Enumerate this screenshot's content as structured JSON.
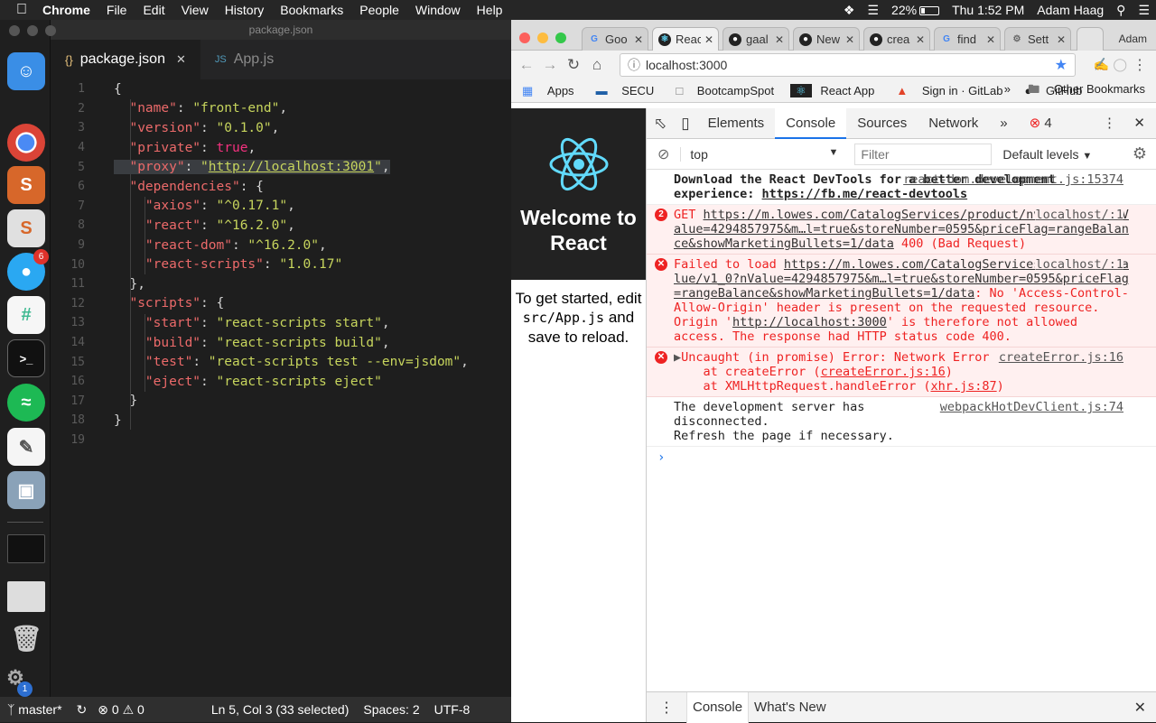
{
  "menubar": {
    "app": "Chrome",
    "items": [
      "File",
      "Edit",
      "View",
      "History",
      "Bookmarks",
      "People",
      "Window",
      "Help"
    ],
    "battery": "22%",
    "clock": "Thu 1:52 PM",
    "user": "Adam Haag"
  },
  "dock": {
    "messages_badge": "6",
    "settings_badge": "1"
  },
  "editor": {
    "window_title": "package.json",
    "tabs": [
      {
        "icon": "{}",
        "label": "package.json"
      },
      {
        "icon": "JS",
        "label": "App.js"
      }
    ],
    "lines": [
      "1",
      "2",
      "3",
      "4",
      "5",
      "6",
      "7",
      "8",
      "9",
      "10",
      "11",
      "12",
      "13",
      "14",
      "15",
      "16",
      "17",
      "18",
      "19"
    ],
    "code": {
      "open": "{",
      "name_key": "\"name\"",
      "name_val": "\"front-end\"",
      "version_key": "\"version\"",
      "version_val": "\"0.1.0\"",
      "private_key": "\"private\"",
      "private_val": "true",
      "proxy_key": "\"proxy\"",
      "proxy_val": "http://localhost:3001",
      "deps_key": "\"dependencies\"",
      "axios_key": "\"axios\"",
      "axios_val": "\"^0.17.1\"",
      "react_key": "\"react\"",
      "react_val": "\"^16.2.0\"",
      "reactdom_key": "\"react-dom\"",
      "reactdom_val": "\"^16.2.0\"",
      "rs_key": "\"react-scripts\"",
      "rs_val": "\"1.0.17\"",
      "scripts_key": "\"scripts\"",
      "start_key": "\"start\"",
      "start_val": "\"react-scripts start\"",
      "build_key": "\"build\"",
      "build_val": "\"react-scripts build\"",
      "test_key": "\"test\"",
      "test_val": "\"react-scripts test --env=jsdom\"",
      "eject_key": "\"eject\"",
      "eject_val": "\"react-scripts eject\""
    }
  },
  "statusbar": {
    "branch": "master*",
    "errors": "0",
    "warnings": "0",
    "position": "Ln 5, Col 3 (33 selected)",
    "spaces": "Spaces: 2",
    "encoding": "UTF-8"
  },
  "chrome": {
    "tabs": [
      "Goo",
      "Reac",
      "gaal",
      "New",
      "crea",
      "find",
      "Sett"
    ],
    "profile": "Adam",
    "url": "localhost:3000",
    "bookmarks": [
      "Apps",
      "SECU",
      "BootcampSpot",
      "React App",
      "Sign in · GitLab",
      "GitHub"
    ],
    "other_bookmarks": "Other Bookmarks"
  },
  "react_page": {
    "title": "Welcome to React",
    "intro_1": "To get started, edit",
    "intro_code": "src/App.js",
    "intro_2": "and save to reload."
  },
  "devtools": {
    "tabs": [
      "Elements",
      "Console",
      "Sources",
      "Network"
    ],
    "error_count": "4",
    "context": "top",
    "filter_placeholder": "Filter",
    "levels": "Default levels",
    "messages": {
      "m1_text": "Download the React DevTools for a better development experience: ",
      "m1_link": "https://fb.me/react-devtools",
      "m1_src": "react-dom.development.js:15374",
      "m2_count": "2",
      "m2_prefix": "GET ",
      "m2_url": "https://m.lowes.com/CatalogServices/product/nvalue/v1_0?nValue=4294857975&m…l=true&storeNumber=0595&priceFlag=rangeBalance&showMarketingBullets=1/data",
      "m2_status": " 400 (Bad Request)",
      "m2_src": "localhost/:1",
      "m3_prefix": "Failed to load ",
      "m3_url": "https://m.lowes.com/CatalogServices/product/nvalue/v1_0?nValue=4294857975&m…l=true&storeNumber=0595&priceFlag=rangeBalance&showMarketingBullets=1/data",
      "m3_text": ": No 'Access-Control-Allow-Origin' header is present on the requested resource. Origin '",
      "m3_origin": "http://localhost:3000",
      "m3_tail": "' is therefore not allowed access. The response had HTTP status code 400.",
      "m3_src": "localhost/:1",
      "m4_title": "Uncaught (in promise) Error: Network Error",
      "m4_l1": "at createError (",
      "m4_l1_link": "createError.js:16",
      "m4_l2": "at XMLHttpRequest.handleError (",
      "m4_l2_link": "xhr.js:87",
      "m4_src": "createError.js:16",
      "m5_text": "The development server has disconnected.",
      "m5_text2": "Refresh the page if necessary.",
      "m5_src": "webpackHotDevClient.js:74"
    },
    "drawer_tabs": [
      "Console",
      "What's New"
    ]
  },
  "colors": {
    "editor_bg": "#1e1e1e",
    "error_red": "#e22",
    "react_blue": "#61dafb",
    "accent": "#1a73e8"
  }
}
